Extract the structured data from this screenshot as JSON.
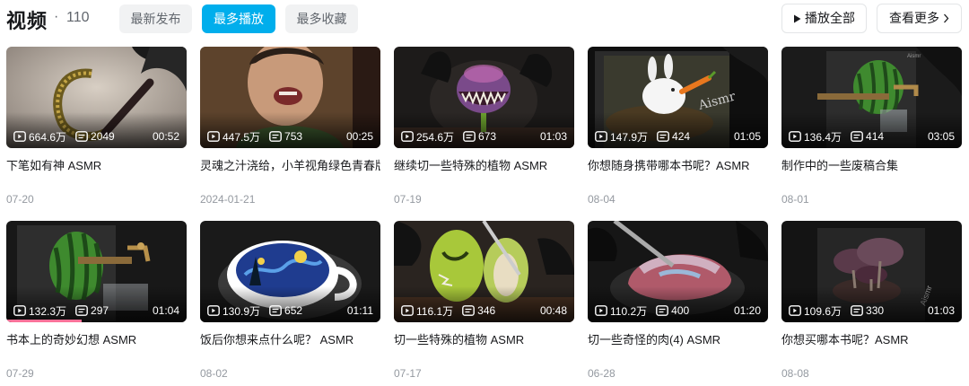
{
  "header": {
    "title": "视频",
    "separator": "·",
    "count": "110",
    "sort_tabs": [
      {
        "label": "最新发布",
        "active": false
      },
      {
        "label": "最多播放",
        "active": true
      },
      {
        "label": "最多收藏",
        "active": false
      }
    ],
    "play_all_label": "播放全部",
    "view_more_label": "查看更多"
  },
  "colors": {
    "accent": "#00aeec",
    "progress": "#fb7299",
    "date_gray": "#9499a0"
  },
  "videos": [
    {
      "title": "下笔如有神 ASMR",
      "views": "664.6万",
      "danmaku": "2049",
      "duration": "00:52",
      "date": "07-20",
      "icon_theme": "pen-drawing-thumbnail"
    },
    {
      "title": "灵魂之汁浇给，小羊视角绿色青春版",
      "views": "447.5万",
      "danmaku": "753",
      "duration": "00:25",
      "date": "2024-01-21",
      "icon_theme": "man-shouting-thumbnail"
    },
    {
      "title": "继续切一些特殊的植物 ASMR",
      "views": "254.6万",
      "danmaku": "673",
      "duration": "01:03",
      "date": "07-19",
      "icon_theme": "piranha-plant-thumbnail"
    },
    {
      "title": "你想随身携带哪本书呢？ASMR",
      "views": "147.9万",
      "danmaku": "424",
      "duration": "01:05",
      "date": "08-04",
      "icon_theme": "rabbit-book-thumbnail"
    },
    {
      "title": "制作中的一些废稿合集",
      "views": "136.4万",
      "danmaku": "414",
      "duration": "03:05",
      "date": "08-01",
      "icon_theme": "watermelon-faucet-thumbnail"
    },
    {
      "title": "书本上的奇妙幻想 ASMR",
      "views": "132.3万",
      "danmaku": "297",
      "duration": "01:04",
      "date": "07-29",
      "icon_theme": "watermelon-book-thumbnail",
      "watched_fraction": 0.42
    },
    {
      "title": "饭后你想来点什么呢？ ASMR",
      "views": "130.9万",
      "danmaku": "652",
      "duration": "01:11",
      "date": "08-02",
      "icon_theme": "starry-night-cup-thumbnail"
    },
    {
      "title": "切一些特殊的植物 ASMR",
      "views": "116.1万",
      "danmaku": "346",
      "duration": "00:48",
      "date": "07-17",
      "icon_theme": "plant-cut-thumbnail"
    },
    {
      "title": "切一些奇怪的肉(4) ASMR",
      "views": "110.2万",
      "danmaku": "400",
      "duration": "01:20",
      "date": "06-28",
      "icon_theme": "strange-meat-thumbnail"
    },
    {
      "title": "你想买哪本书呢？ASMR",
      "views": "109.6万",
      "danmaku": "330",
      "duration": "01:03",
      "date": "08-08",
      "icon_theme": "mushroom-book-thumbnail"
    }
  ]
}
